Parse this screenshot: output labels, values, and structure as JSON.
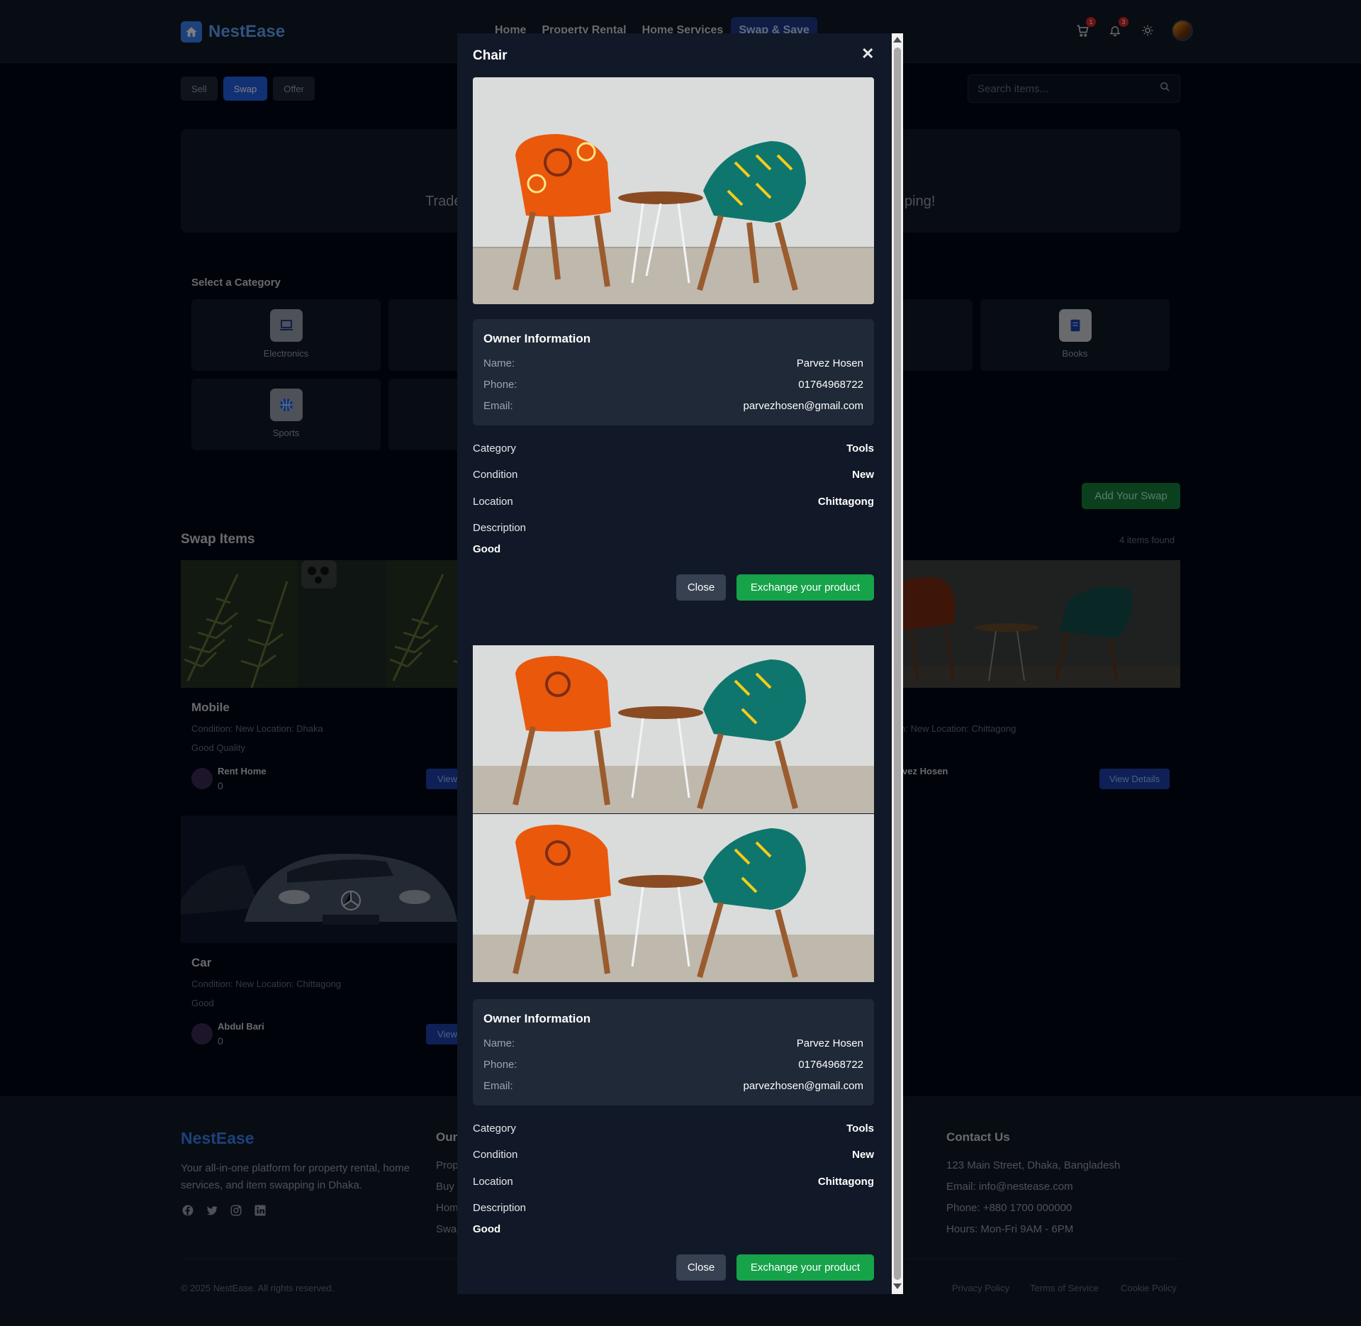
{
  "navbar": {
    "brand": "NestEase",
    "links": [
      "Home",
      "Property Rental",
      "Home Services",
      "Swap & Save"
    ],
    "cart_count": "1",
    "notif_count": "3"
  },
  "filters": {
    "tabs": [
      "Sell",
      "Swap",
      "Offer"
    ],
    "search_placeholder": "Search items..."
  },
  "hero": {
    "text_left": "Trade",
    "text_right": "ping!"
  },
  "categories": {
    "title": "Select a Category",
    "items": [
      "Electronics",
      "Books",
      "Sports"
    ]
  },
  "swap": {
    "add_button": "Add Your Swap",
    "title": "Swap Items",
    "count": "4 items found",
    "items": [
      {
        "title": "Mobile",
        "meta": "Condition: New   Location: Dhaka",
        "desc": "Good Quality",
        "owner": "Rent Home",
        "num": "0",
        "view": "View"
      },
      {
        "title": "Car",
        "meta": "Condition: New   Location: Chittagong",
        "desc": "Good",
        "owner": "Abdul Bari",
        "num": "0",
        "view": "View"
      },
      {
        "meta": "n: New   Location: Chittagong",
        "owner": "rvez Hosen",
        "view": "View Details"
      }
    ]
  },
  "footer": {
    "brand": "NestEase",
    "desc": "Your all-in-one platform for property rental, home services, and item swapping in Dhaka.",
    "col2_title": "Our",
    "col2_links": [
      "Prop",
      "Buy",
      "Hom",
      "Swa"
    ],
    "contact_title": "Contact Us",
    "contact": [
      "123 Main Street, Dhaka, Bangladesh",
      "Email: info@nestease.com",
      "Phone: +880 1700 000000",
      "Hours: Mon-Fri 9AM - 6PM"
    ],
    "copyright": "© 2025 NestEase. All rights reserved.",
    "legal": [
      "Privacy Policy",
      "Terms of Service",
      "Cookie Policy"
    ]
  },
  "modal": {
    "title": "Chair",
    "owner_title": "Owner Information",
    "owner": {
      "name_label": "Name:",
      "name": "Parvez Hosen",
      "phone_label": "Phone:",
      "phone": "01764968722",
      "email_label": "Email:",
      "email": "parvezhosen@gmail.com"
    },
    "details": {
      "category_label": "Category",
      "category": "Tools",
      "condition_label": "Condition",
      "condition": "New",
      "location_label": "Location",
      "location": "Chittagong",
      "description_label": "Description",
      "description": "Good"
    },
    "close": "Close",
    "exchange": "Exchange your product"
  },
  "colors": {
    "accent": "#2563eb",
    "success": "#16a34a",
    "bg": "#020617",
    "panel": "#111827"
  }
}
